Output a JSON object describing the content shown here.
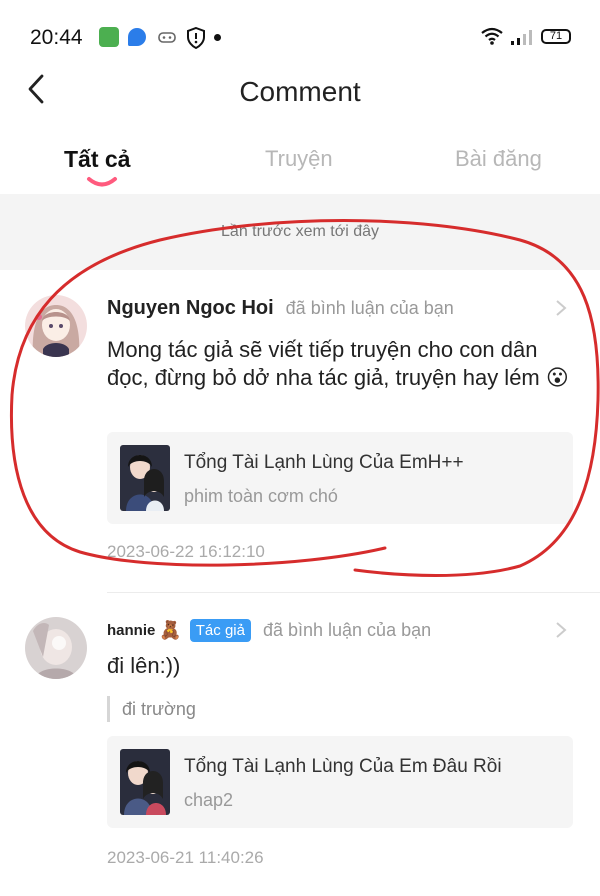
{
  "status_bar": {
    "time": "20:44",
    "battery": "71",
    "icons": [
      "app-icon-green",
      "app-icon-blue",
      "game-controller-icon",
      "shield-icon",
      "dot-icon",
      "wifi-icon",
      "signal-icon",
      "battery-icon"
    ]
  },
  "header": {
    "title": "Comment",
    "back_icon": "chevron-left-icon"
  },
  "tabs": [
    {
      "label": "Tất cả",
      "active": true
    },
    {
      "label": "Truyện",
      "active": false
    },
    {
      "label": "Bài đăng",
      "active": false
    }
  ],
  "colors": {
    "tab_indicator": "#ff5a7e",
    "author_badge": "#3a9cf5",
    "annotation": "#d62c2c"
  },
  "banner": {
    "text": "Lần trước xem tới đây"
  },
  "comments": [
    {
      "user": "Nguyen Ngoc Hoi",
      "action": "đã bình luận của bạn",
      "text": "Mong tác giả sẽ viết tiếp truyện cho con dân đọc, đừng bỏ dở nha tác giả, truyện hay lém 😮",
      "story": {
        "title": "Tổng Tài Lạnh Lùng Của EmH++",
        "subtitle": "phim toàn cơm chó"
      },
      "timestamp": "2023-06-22 16:12:10"
    },
    {
      "user": "hannie",
      "emoji": "🧸",
      "badge": "Tác giả",
      "action": "đã bình luận của bạn",
      "text": "đi lên:))",
      "quote": "đi trường",
      "story": {
        "title": "Tổng Tài Lạnh Lùng Của Em Đâu Rồi",
        "subtitle": "chap2"
      },
      "timestamp": "2023-06-21 11:40:26"
    }
  ]
}
